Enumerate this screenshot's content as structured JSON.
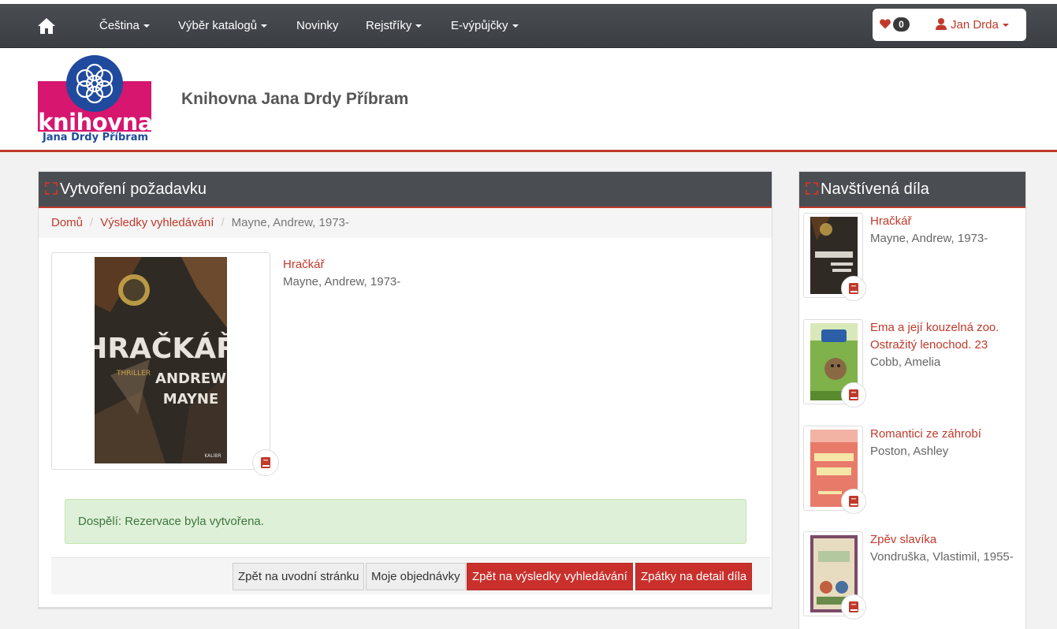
{
  "navbar": {
    "language": "Čeština",
    "catalog": "Výběr katalogů",
    "news": "Novinky",
    "registers": "Rejstříky",
    "ebooks": "E-výpůjčky",
    "favorites_count": "0",
    "user_name": "Jan Drda"
  },
  "header": {
    "logo_text": "knihovna",
    "logo_subtext": "Jana Drdy Příbram",
    "title": "Knihovna Jana Drdy Příbram"
  },
  "main": {
    "panel_title": "Vytvoření požadavku",
    "breadcrumb": [
      "Domů",
      "Výsledky vyhledávání",
      "Mayne, Andrew, 1973-"
    ],
    "record": {
      "title": "Hračkář",
      "author": "Mayne, Andrew, 1973-",
      "cover_title": "HRAČKÁŘ",
      "cover_author_1": "ANDREW",
      "cover_author_2": "MAYNE",
      "cover_genre": "THRILLER",
      "cover_publisher": "KALIBR"
    },
    "alert": "Dospělí: Rezervace byla vytvořena.",
    "buttons": {
      "home": "Zpět na uvodní stránku",
      "orders": "Moje objednávky",
      "results": "Zpět na výsledky vyhledávání",
      "detail": "Zpátky na detail díla"
    }
  },
  "sidebar": {
    "title": "Navštívená díla",
    "items": [
      {
        "title": "Hračkář",
        "author": "Mayne, Andrew, 1973-"
      },
      {
        "title": "Ema a její kouzelná zoo. Ostražitý lenochod. 23",
        "author": "Cobb, Amelia"
      },
      {
        "title": "Romantici ze záhrobí",
        "author": "Poston, Ashley"
      },
      {
        "title": "Zpěv slavíka",
        "author": "Vondruška, Vlastimil, 1955-"
      }
    ]
  },
  "colors": {
    "accent": "#c0392b",
    "navbar": "#45484d",
    "success_bg": "#dff0d8",
    "success_text": "#3c763d"
  }
}
